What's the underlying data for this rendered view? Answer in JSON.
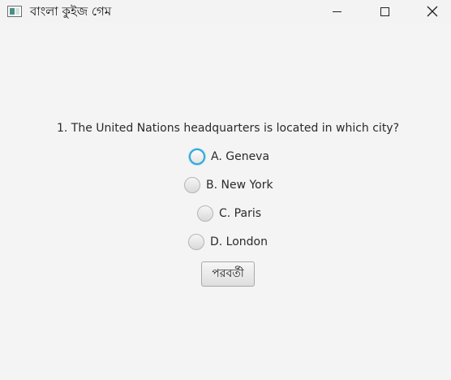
{
  "window": {
    "title": "বাংলা কুইজ গেম"
  },
  "quiz": {
    "question": "1. The United Nations headquarters is located in which city?",
    "options": [
      {
        "label": "A. Geneva"
      },
      {
        "label": "B. New York"
      },
      {
        "label": "C. Paris"
      },
      {
        "label": "D. London"
      }
    ],
    "focused_option": "A. Geneva",
    "next_label": "পরবর্তী"
  },
  "colors": {
    "background": "#f4f4f4",
    "focus_ring": "#2ea7d9"
  },
  "icons": {
    "app": "app-window-icon",
    "minimize": "minimize-icon",
    "maximize": "maximize-icon",
    "close": "close-icon"
  }
}
